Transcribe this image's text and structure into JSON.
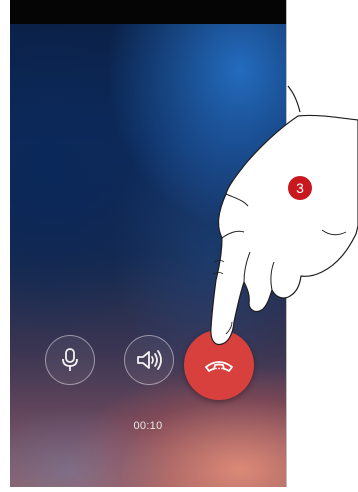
{
  "call": {
    "timer": "00:10",
    "controls": {
      "mic_icon": "microphone-icon",
      "speaker_icon": "speaker-icon",
      "end_call_icon": "hang-up-icon"
    }
  },
  "annotation": {
    "step_number": "3"
  },
  "colors": {
    "end_call": "#d8403e",
    "badge": "#c8171e"
  }
}
